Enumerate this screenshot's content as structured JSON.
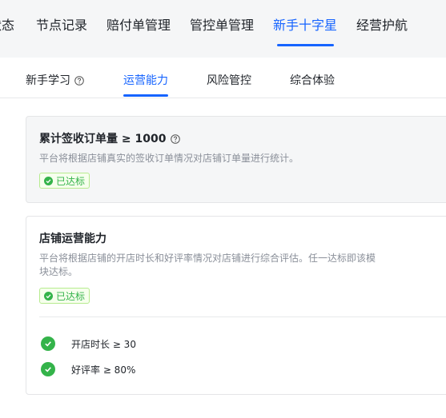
{
  "top_nav": {
    "tabs": [
      {
        "label": "状态"
      },
      {
        "label": "节点记录"
      },
      {
        "label": "赔付单管理"
      },
      {
        "label": "管控单管理"
      },
      {
        "label": "新手十字星"
      },
      {
        "label": "经营护航"
      }
    ],
    "active_index": 4
  },
  "sub_nav": {
    "tabs": [
      {
        "label": "新手学习"
      },
      {
        "label": "运营能力"
      },
      {
        "label": "风险管控"
      },
      {
        "label": "综合体验"
      }
    ],
    "active_index": 1
  },
  "cards": [
    {
      "title": "累计签收订单量 ≥ 1000",
      "description": "平台将根据店铺真实的签收订单情况对店铺订单量进行统计。",
      "status": "已达标"
    },
    {
      "title": "店铺运营能力",
      "description": "平台将根据店铺的开店时长和好评率情况对店铺进行综合评估。任一达标即该模块达标。",
      "status": "已达标",
      "criteria": [
        {
          "label": "开店时长 ≥ 30",
          "met": true
        },
        {
          "label": "好评率 ≥ 80%",
          "met": true
        }
      ]
    }
  ],
  "colors": {
    "accent": "#1664ff",
    "success": "#34b34a",
    "success_bg": "#f6ffed",
    "text_primary": "#1f2329",
    "text_secondary": "#8a8f99"
  },
  "icons": {
    "help": "question-circle-icon",
    "check": "check-circle-icon"
  }
}
